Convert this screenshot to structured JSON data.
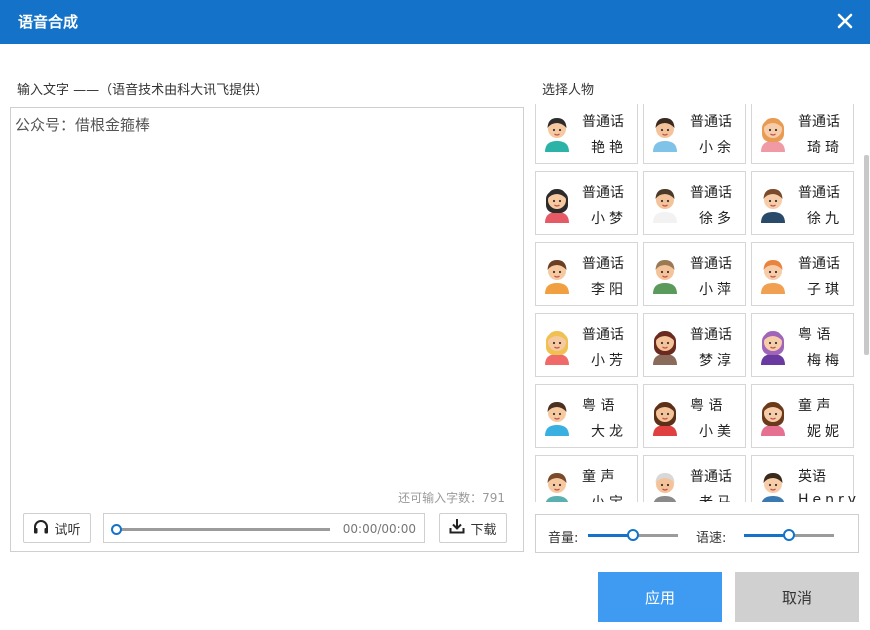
{
  "dialog": {
    "title": "语音合成",
    "accent_color": "#1473c8",
    "close_icon": "close-icon"
  },
  "input_section": {
    "label": "输入文字 ——（语音技术由科大讯飞提供）",
    "text": "公众号：借根金箍棒",
    "remaining_label": "还可输入字数：",
    "remaining_count": "791"
  },
  "player": {
    "listen_label": "试听",
    "listen_icon": "headphones-icon",
    "time": "00:00/00:00",
    "download_label": "下载",
    "download_icon": "download-icon"
  },
  "characters": {
    "label": "选择人物",
    "items": [
      {
        "lang": "普通话",
        "name": "艳艳"
      },
      {
        "lang": "普通话",
        "name": "小余"
      },
      {
        "lang": "普通话",
        "name": "琦琦"
      },
      {
        "lang": "普通话",
        "name": "小梦"
      },
      {
        "lang": "普通话",
        "name": "徐多"
      },
      {
        "lang": "普通话",
        "name": "徐九"
      },
      {
        "lang": "普通话",
        "name": "李阳"
      },
      {
        "lang": "普通话",
        "name": "小萍"
      },
      {
        "lang": "普通话",
        "name": "子琪"
      },
      {
        "lang": "普通话",
        "name": "小芳"
      },
      {
        "lang": "普通话",
        "name": "梦淳"
      },
      {
        "lang": "粤 语",
        "name": "梅梅"
      },
      {
        "lang": "粤 语",
        "name": "大龙"
      },
      {
        "lang": "粤 语",
        "name": "小美"
      },
      {
        "lang": "童 声",
        "name": "妮妮"
      },
      {
        "lang": "童 声",
        "name": "小宝"
      },
      {
        "lang": "普通话",
        "name": "老马"
      },
      {
        "lang": "英语",
        "name": "Henry"
      }
    ]
  },
  "controls": {
    "volume_label": "音量:",
    "speed_label": "语速:",
    "volume_level": 0.5,
    "speed_level": 0.5
  },
  "actions": {
    "apply_label": "应用",
    "cancel_label": "取消"
  }
}
